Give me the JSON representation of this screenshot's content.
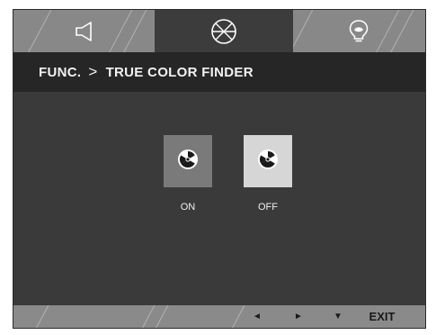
{
  "tabs": [
    {
      "icon": "speaker-icon",
      "active": false
    },
    {
      "icon": "color-wheel-icon",
      "active": true
    },
    {
      "icon": "lightbulb-icon",
      "active": false
    }
  ],
  "header": {
    "section": "FUNC.",
    "separator": ">",
    "title": "TRUE COLOR FINDER"
  },
  "options": [
    {
      "label": "ON",
      "icon": "true-color-icon",
      "selected": false
    },
    {
      "label": "OFF",
      "icon": "true-color-icon",
      "selected": true
    }
  ],
  "footer": {
    "left_label": "◄",
    "right_label": "►",
    "down_label": "▼",
    "exit_label": "EXIT"
  },
  "colors": {
    "panel_bg": "#3a3a3a",
    "title_bg": "#262626",
    "tab_inactive": "#888888",
    "option_off_bg": "#d6d6d6",
    "option_on_bg": "#7a7a7a"
  }
}
